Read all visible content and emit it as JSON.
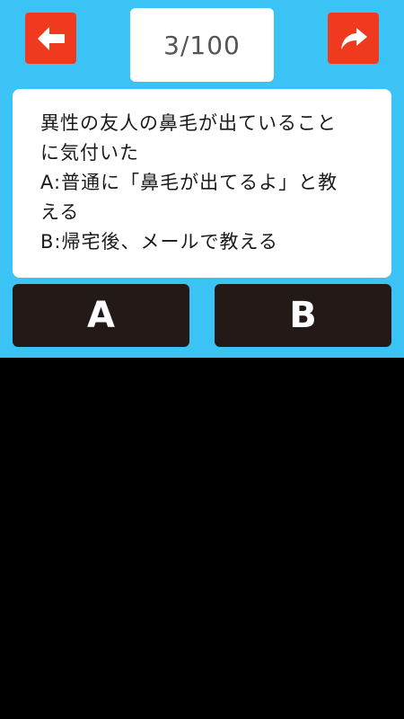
{
  "header": {
    "progress": "3/100",
    "back_icon": "back-arrow-icon",
    "share_icon": "share-arrow-icon"
  },
  "question": {
    "lines": [
      "異性の友人の鼻毛が出ていること",
      "に気付いた",
      "A:普通に「鼻毛が出てるよ」と教",
      "える",
      "B:帰宅後、メールで教える"
    ]
  },
  "answers": {
    "a_label": "A",
    "b_label": "B"
  },
  "colors": {
    "background_top": "#3cc3f5",
    "nav_button": "#f03a1f",
    "answer_button": "#231a17",
    "card": "#ffffff",
    "bottom_area": "#000000"
  }
}
